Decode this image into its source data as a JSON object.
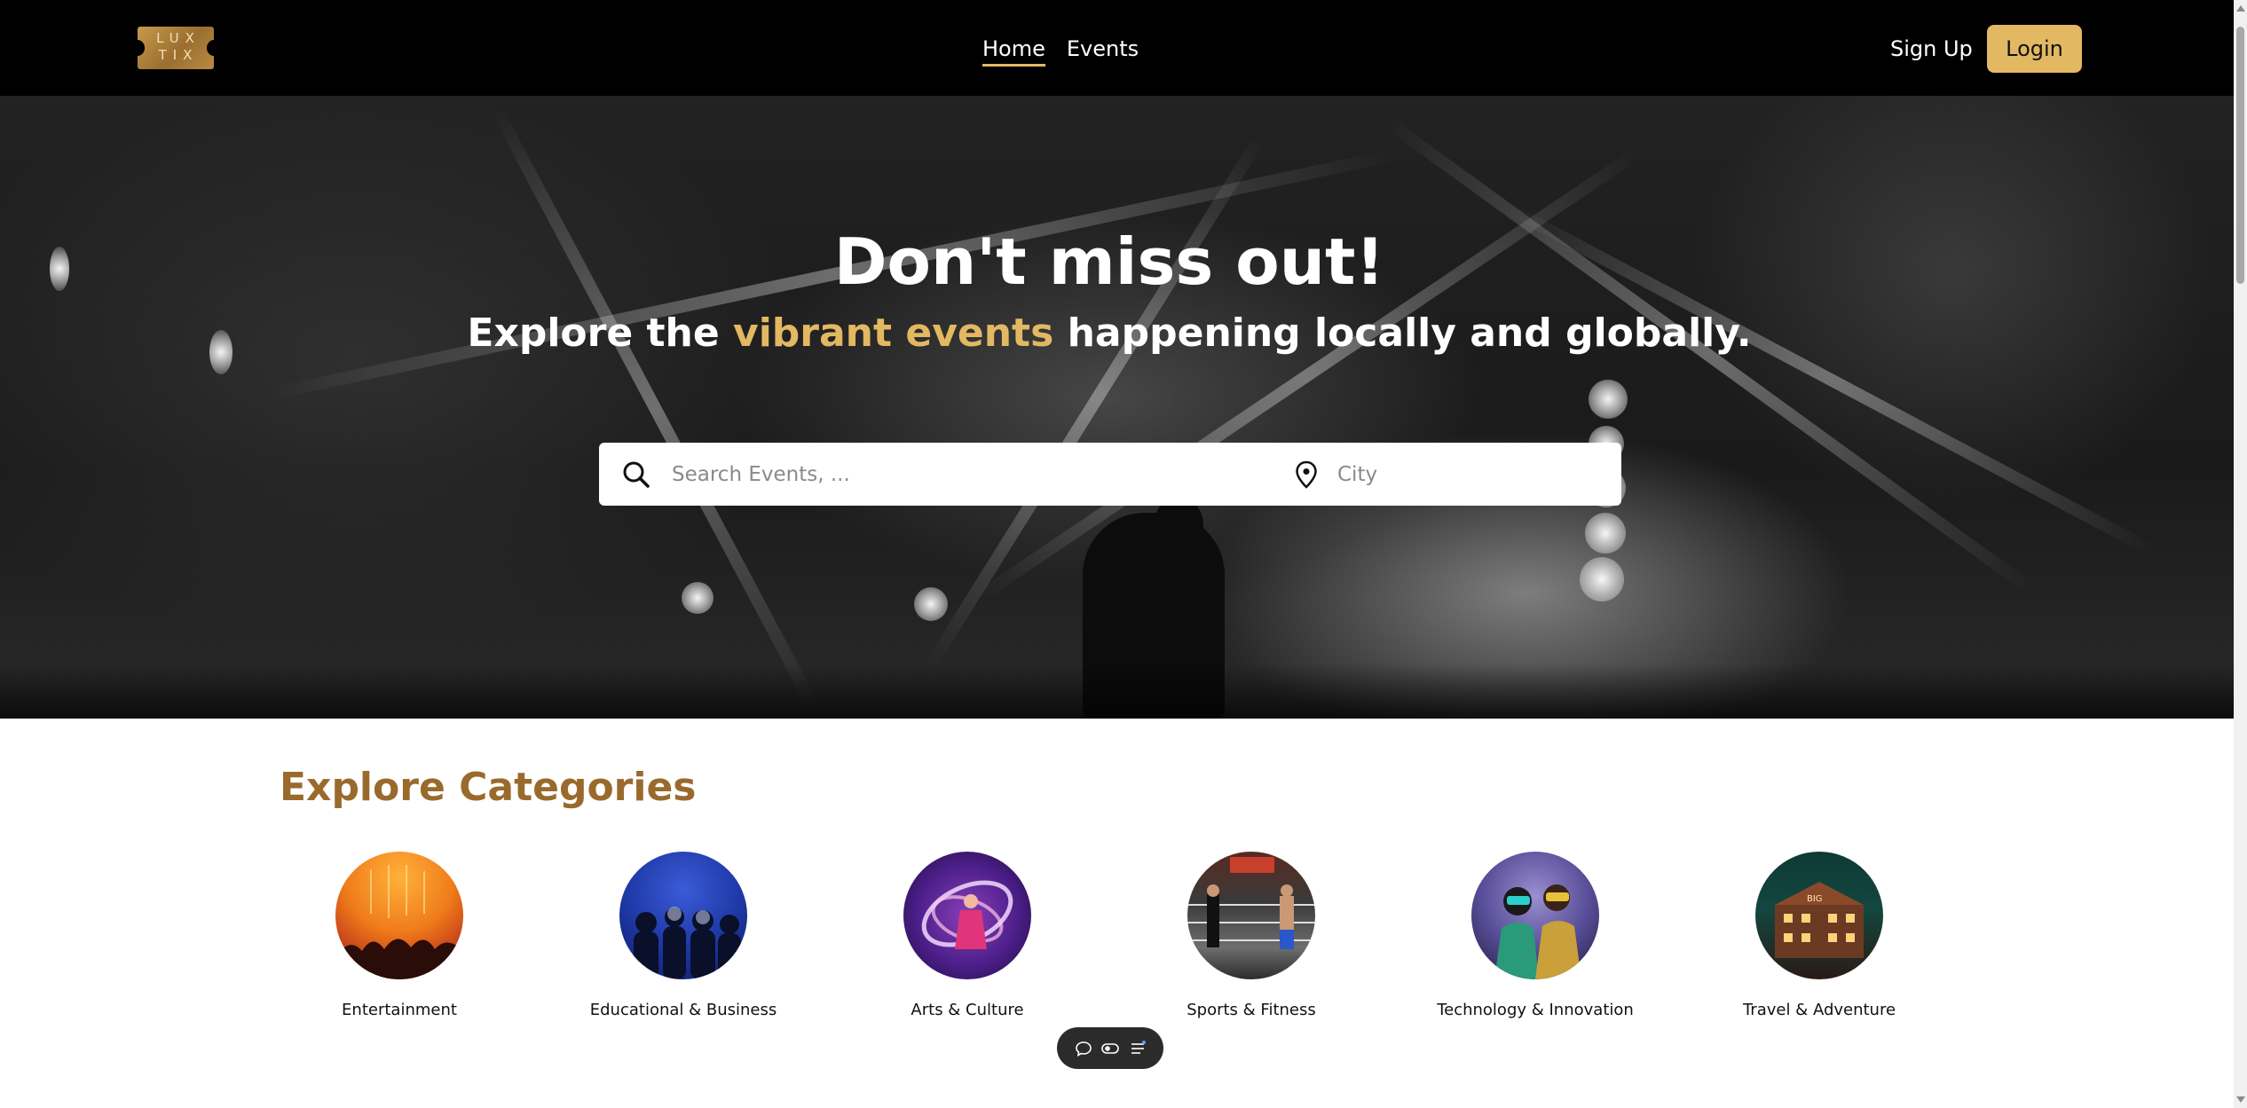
{
  "header": {
    "logo_text": "LUX\nTIX",
    "nav": [
      {
        "label": "Home",
        "active": true
      },
      {
        "label": "Events",
        "active": false
      }
    ],
    "signup_label": "Sign Up",
    "login_label": "Login"
  },
  "hero": {
    "title": "Don't miss out!",
    "subtitle_before": "Explore the ",
    "subtitle_accent": "vibrant events",
    "subtitle_after": " happening locally and globally.",
    "search_placeholder": "Search Events, ...",
    "city_placeholder": "City"
  },
  "categories": {
    "title": "Explore Categories",
    "items": [
      {
        "label": "Entertainment"
      },
      {
        "label": "Educational & Business"
      },
      {
        "label": "Arts & Culture"
      },
      {
        "label": "Sports & Fitness"
      },
      {
        "label": "Technology & Innovation"
      },
      {
        "label": "Travel & Adventure"
      }
    ]
  },
  "toolbar": {
    "icons": [
      "chat-icon",
      "toggle-icon",
      "list-icon"
    ]
  },
  "colors": {
    "accent": "#e3b862",
    "section_title": "#9a6a2c",
    "header_bg": "#000000"
  }
}
